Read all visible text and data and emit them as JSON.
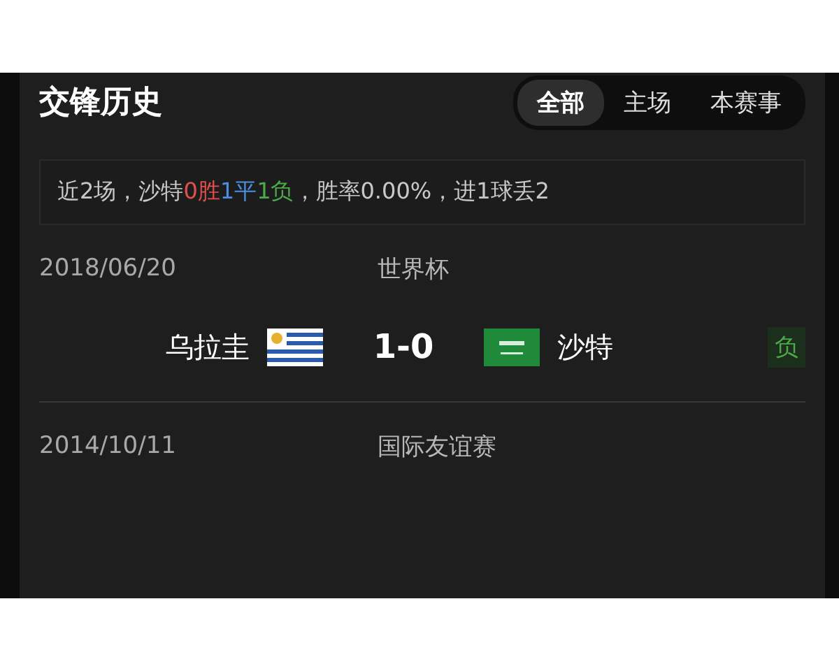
{
  "title": "交锋历史",
  "tabs": [
    {
      "label": "全部",
      "selected": true
    },
    {
      "label": "主场",
      "selected": false
    },
    {
      "label": "本赛事",
      "selected": false
    }
  ],
  "summary": [
    {
      "text": "近2场，沙特"
    },
    {
      "text": "0胜",
      "color": "#e0504c"
    },
    {
      "text": "1平",
      "color": "#4a8fe0"
    },
    {
      "text": "1负",
      "color": "#4caa4a"
    },
    {
      "text": "，胜率0.00%，进1球丢2"
    }
  ],
  "matches": [
    {
      "date": "2018/06/20",
      "competition": "世界杯",
      "home": {
        "name": "乌拉圭",
        "kind": "uruguay"
      },
      "score": "1-0",
      "away": {
        "name": "沙特",
        "kind": "saudi"
      },
      "result": "负"
    },
    {
      "date": "2014/10/11",
      "competition": "国际友谊赛"
    }
  ]
}
